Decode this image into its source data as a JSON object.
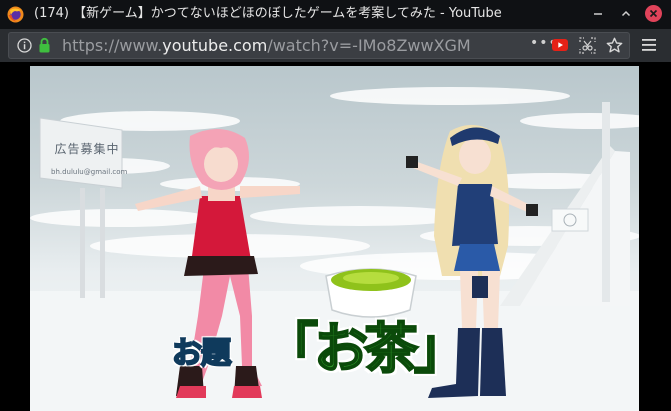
{
  "window": {
    "tab_title": "(174) 【新ゲーム】かつてないほどほのぼしたゲームを考案してみた - YouTube",
    "icons": [
      "firefox-icon",
      "minimize-icon",
      "maximize-icon",
      "close-icon"
    ],
    "close_color": "#e0435a"
  },
  "toolbar": {
    "url_prefix": "https://www.",
    "url_domain": "youtube.com",
    "url_path": "/watch?v=-IMo8ZwwXGM",
    "page_actions": "•••",
    "icons": [
      "info-icon",
      "lock-icon",
      "page-actions-icon",
      "youtube-icon",
      "screenshot-icon",
      "bookmark-star-icon",
      "hamburger-menu-icon"
    ],
    "lock_color": "#3fbf3f"
  },
  "video": {
    "billboard_text": "広告募集中",
    "billboard_email": "bh.dululu@gmail.com",
    "caption_label": "お題",
    "caption_topic": "「お茶」",
    "caption_label_color": "#2aa9e0",
    "caption_topic_color": "#2f9a2a"
  }
}
